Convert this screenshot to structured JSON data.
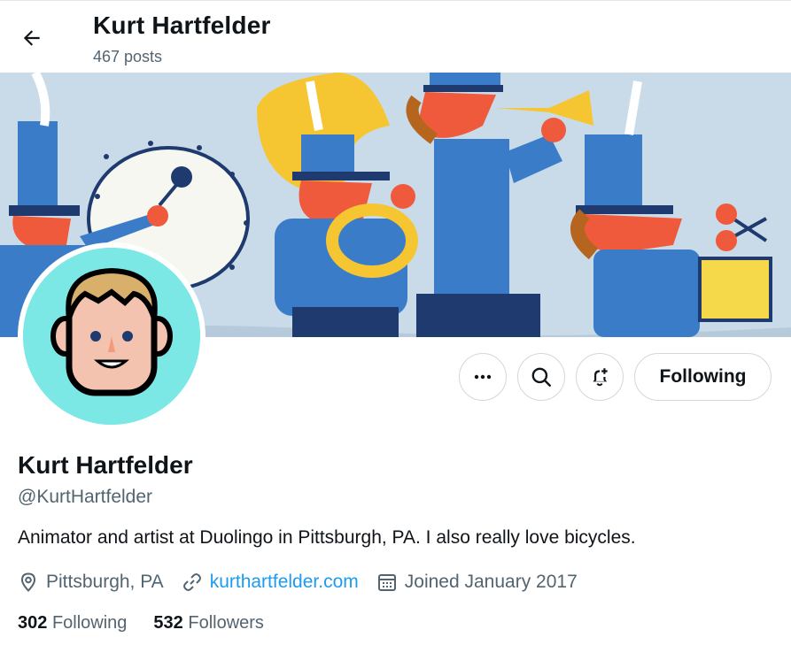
{
  "header": {
    "name": "Kurt Hartfelder",
    "posts": "467 posts"
  },
  "profile": {
    "name": "Kurt Hartfelder",
    "handle": "@KurtHartfelder",
    "bio": "Animator and artist at Duolingo in Pittsburgh, PA. I also really love bicycles.",
    "location": "Pittsburgh, PA",
    "website": "kurthartfelder.com",
    "joined": "Joined January 2017"
  },
  "actions": {
    "follow_label": "Following"
  },
  "stats": {
    "following_count": "302",
    "following_label": "Following",
    "followers_count": "532",
    "followers_label": "Followers"
  },
  "colors": {
    "accent": "#1d9bf0",
    "secondary_text": "#536471",
    "avatar_bg": "#7be8e6",
    "banner_bg": "#c9dbe9"
  },
  "icons": [
    "back-arrow-icon",
    "more-icon",
    "search-icon",
    "bell-plus-icon",
    "location-icon",
    "link-icon",
    "calendar-icon"
  ]
}
